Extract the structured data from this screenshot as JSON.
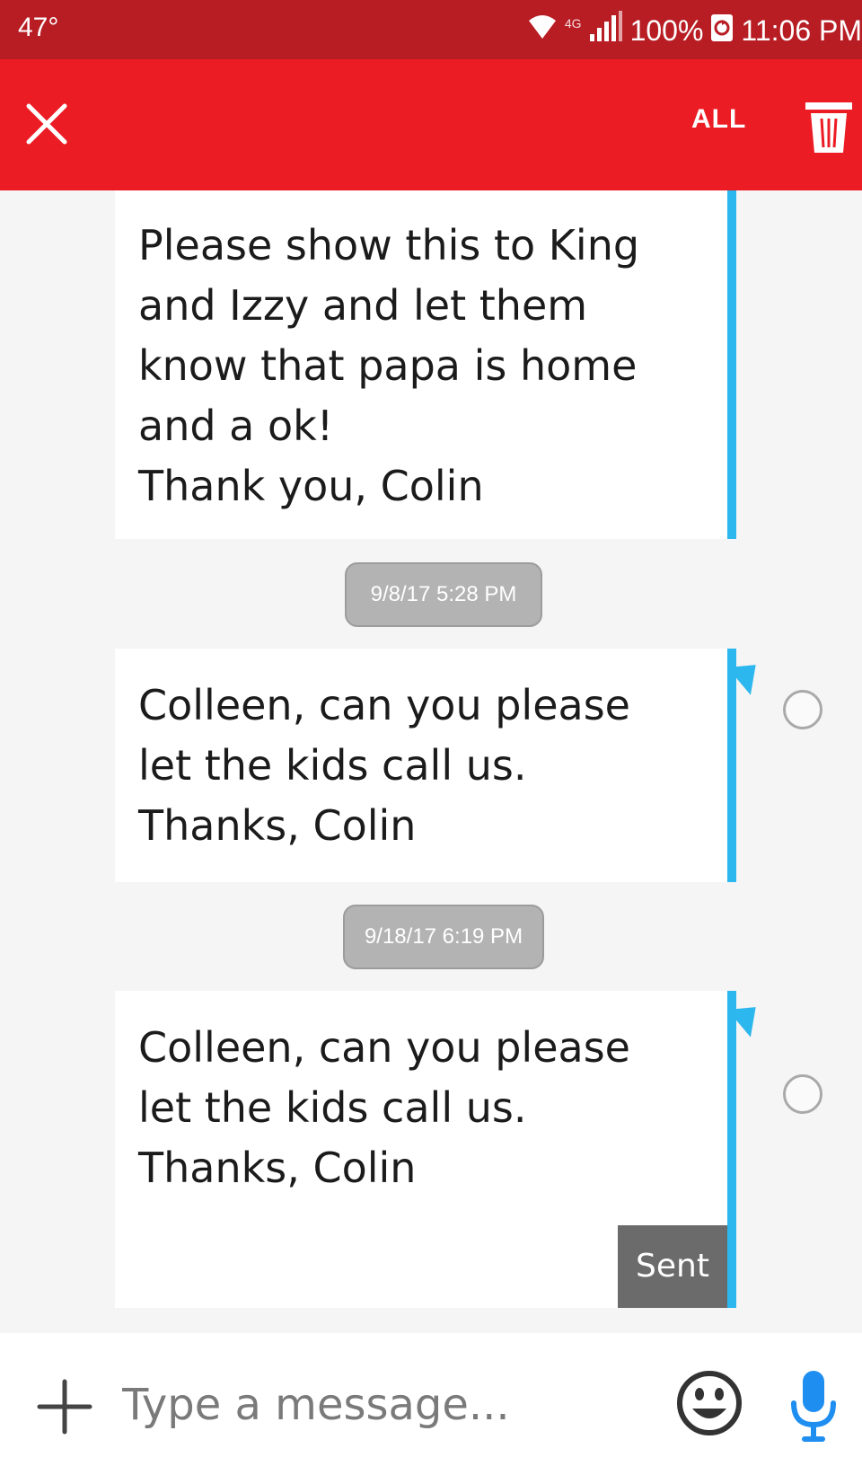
{
  "status_bar": {
    "temperature": "47°",
    "network": "4G",
    "battery": "100%",
    "time": "11:06 PM",
    "icons": [
      "wifi-icon",
      "signal-icon",
      "sync-icon"
    ]
  },
  "action_bar": {
    "close_icon": "close-icon",
    "select_all_label": "ALL",
    "delete_icon": "trash-icon"
  },
  "messages": [
    {
      "text": "Please show this to King\nand Izzy and let them\nknow that papa is home\nand a ok!\nThank you, Colin"
    },
    {
      "timestamp": "9/8/17 5:28 PM",
      "text": "Colleen, can you please\nlet the kids call us.\nThanks, Colin"
    },
    {
      "timestamp": "9/18/17 6:19 PM",
      "text": "Colleen, can you please\nlet the kids call us.\nThanks, Colin",
      "status": "Sent"
    }
  ],
  "composer": {
    "placeholder": "Type a message...",
    "value": "",
    "icons": [
      "plus-icon",
      "emoji-icon",
      "microphone-icon"
    ]
  },
  "colors": {
    "status_bar": "#b81d24",
    "action_bar": "#ec1c24",
    "accent_blue": "#2cb7ee",
    "mic_blue": "#1e8ef0"
  }
}
